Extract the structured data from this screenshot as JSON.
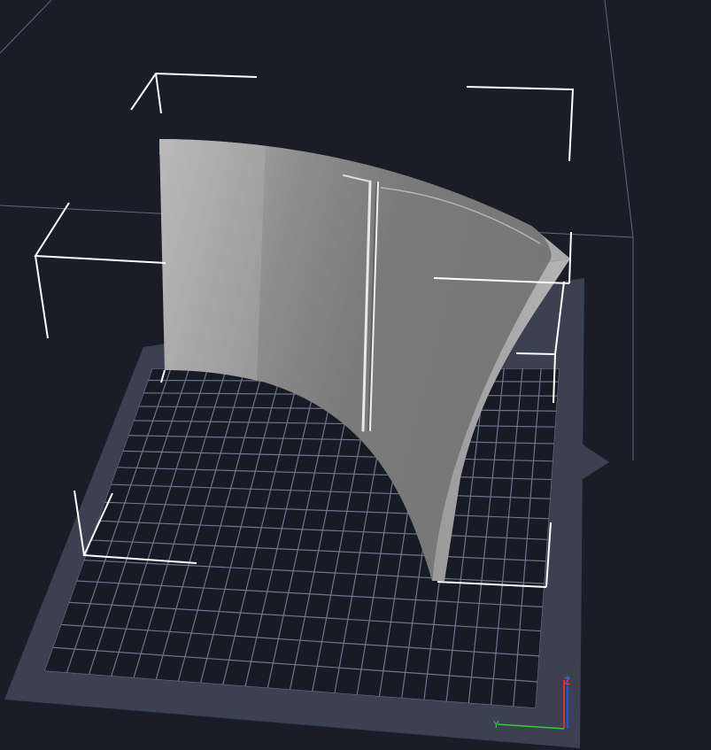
{
  "viewport": {
    "background_color": "#1a1d27",
    "bed_frame_color": "#3c4152",
    "bed_surface_color": "#171b26",
    "grid_color": "#8b93ae",
    "model_color": "#8a8a8a",
    "selection_box_color": "#ffffff",
    "build_volume_color": "#6f7489"
  },
  "axes": {
    "x_label": "X",
    "y_label": "Y",
    "z_label": "Z",
    "x_color": "#ff3030",
    "y_color": "#30d030",
    "z_color": "#3050ff"
  }
}
